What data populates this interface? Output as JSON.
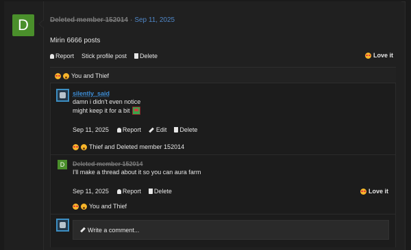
{
  "post": {
    "avatar_letter": "D",
    "author": "Deleted member 152014",
    "separator": "·",
    "date": "Sep 11, 2025",
    "body": "Mirin 6666 posts",
    "actions": {
      "report": "Report",
      "stick": "Stick profile post",
      "delete": "Delete"
    },
    "love_label": "Love it",
    "reactions_text": "You and Thief"
  },
  "comments": [
    {
      "author": "silently_said",
      "lines": [
        "damn i didn't even notice",
        "might keep it for a bit"
      ],
      "date": "Sep 11, 2025",
      "actions": {
        "report": "Report",
        "edit": "Edit",
        "delete": "Delete"
      },
      "reactions_text": "Thief and Deleted member 152014"
    },
    {
      "avatar_letter": "D",
      "author": "Deleted member 152014",
      "body": "I'll make a thread about it so you can aura farm",
      "date": "Sep 11, 2025",
      "actions": {
        "report": "Report",
        "delete": "Delete"
      },
      "love_label": "Love it",
      "reactions_text": "You and Thief"
    }
  ],
  "composer": {
    "placeholder": "Write a comment..."
  },
  "colors": {
    "link": "#4f86c6",
    "author_link": "#3d8ed8",
    "avatar_green": "#4a8f2b",
    "muted": "#7a7a7a"
  },
  "icons": [
    "bell-icon",
    "trash-icon",
    "pencil-icon",
    "heart-eyes-emoji",
    "wow-emoji",
    "cat-emoji"
  ]
}
